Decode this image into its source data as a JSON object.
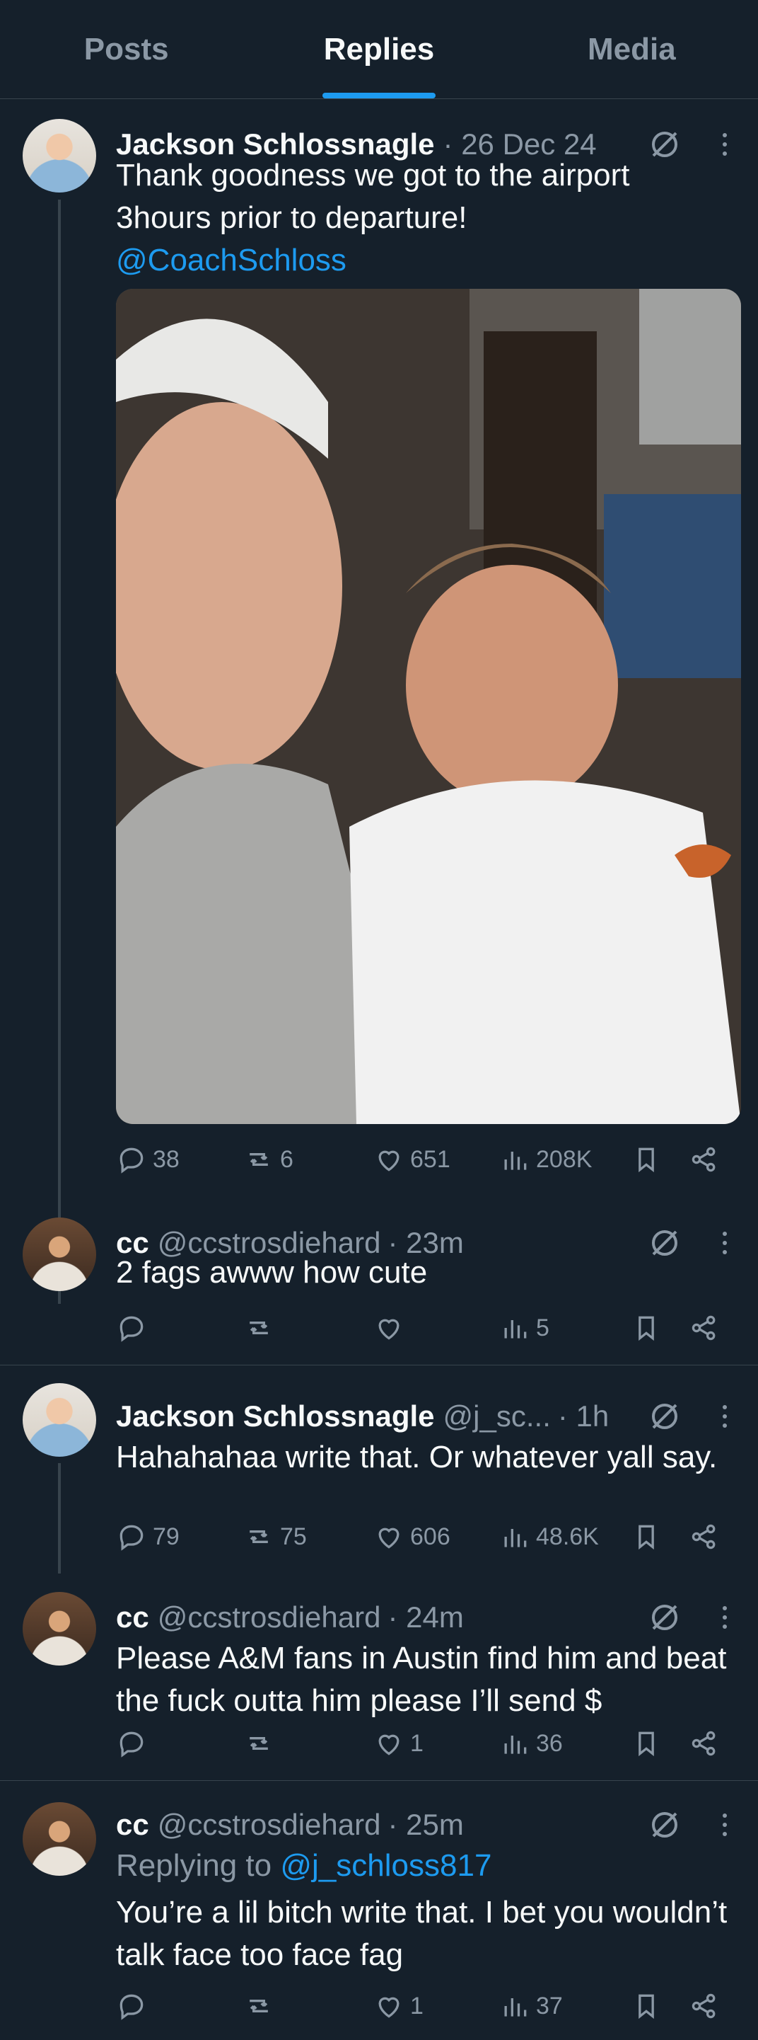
{
  "tabs": [
    "Posts",
    "Replies",
    "Media"
  ],
  "active_tab": "Replies",
  "colors": {
    "background": "#15202b",
    "accent": "#1d9bf0",
    "muted": "#8b98a5",
    "divider": "#38444d"
  },
  "tweets": [
    {
      "name": "Jackson Schlossnagle",
      "handle": "",
      "time": "· 26 Dec 24",
      "text": "Thank goodness we got to the airport 3hours prior to departure!",
      "mention": "@CoachSchloss",
      "has_photo": true,
      "replies": "38",
      "reposts": "6",
      "likes": "651",
      "views": "208K"
    },
    {
      "name": "cc",
      "handle": "@ccstrosdiehard",
      "time": "· 23m",
      "text": "2 fags awww how cute",
      "replies": "",
      "reposts": "",
      "likes": "",
      "views": "5"
    },
    {
      "name": "Jackson Schlossnagle",
      "handle": "@j_sc...",
      "time": "· 1h",
      "text": "Hahahahaa write that. Or whatever yall say.",
      "replies": "79",
      "reposts": "75",
      "likes": "606",
      "views": "48.6K"
    },
    {
      "name": "cc",
      "handle": "@ccstrosdiehard",
      "time": "· 24m",
      "text": "Please A&M fans in Austin find him and beat the fuck outta him please I’ll send $",
      "replies": "",
      "reposts": "",
      "likes": "1",
      "views": "36"
    },
    {
      "name": "cc",
      "handle": "@ccstrosdiehard",
      "time": "· 25m",
      "replying_prefix": "Replying to",
      "replying_to": "@j_schloss817",
      "text": "You’re a lil bitch write that. I bet you wouldn’t talk face too face fag",
      "replies": "",
      "reposts": "",
      "likes": "1",
      "views": "37"
    }
  ]
}
